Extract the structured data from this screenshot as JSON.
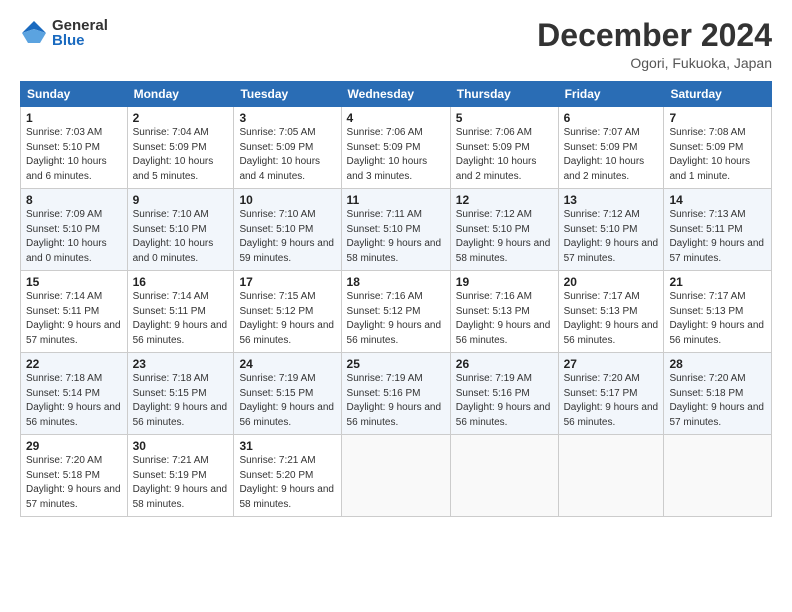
{
  "header": {
    "logo_general": "General",
    "logo_blue": "Blue",
    "month_title": "December 2024",
    "location": "Ogori, Fukuoka, Japan"
  },
  "days_of_week": [
    "Sunday",
    "Monday",
    "Tuesday",
    "Wednesday",
    "Thursday",
    "Friday",
    "Saturday"
  ],
  "weeks": [
    [
      {
        "day": "1",
        "sunrise": "7:03 AM",
        "sunset": "5:10 PM",
        "daylight": "10 hours and 6 minutes."
      },
      {
        "day": "2",
        "sunrise": "7:04 AM",
        "sunset": "5:09 PM",
        "daylight": "10 hours and 5 minutes."
      },
      {
        "day": "3",
        "sunrise": "7:05 AM",
        "sunset": "5:09 PM",
        "daylight": "10 hours and 4 minutes."
      },
      {
        "day": "4",
        "sunrise": "7:06 AM",
        "sunset": "5:09 PM",
        "daylight": "10 hours and 3 minutes."
      },
      {
        "day": "5",
        "sunrise": "7:06 AM",
        "sunset": "5:09 PM",
        "daylight": "10 hours and 2 minutes."
      },
      {
        "day": "6",
        "sunrise": "7:07 AM",
        "sunset": "5:09 PM",
        "daylight": "10 hours and 2 minutes."
      },
      {
        "day": "7",
        "sunrise": "7:08 AM",
        "sunset": "5:09 PM",
        "daylight": "10 hours and 1 minute."
      }
    ],
    [
      {
        "day": "8",
        "sunrise": "7:09 AM",
        "sunset": "5:10 PM",
        "daylight": "10 hours and 0 minutes."
      },
      {
        "day": "9",
        "sunrise": "7:10 AM",
        "sunset": "5:10 PM",
        "daylight": "10 hours and 0 minutes."
      },
      {
        "day": "10",
        "sunrise": "7:10 AM",
        "sunset": "5:10 PM",
        "daylight": "9 hours and 59 minutes."
      },
      {
        "day": "11",
        "sunrise": "7:11 AM",
        "sunset": "5:10 PM",
        "daylight": "9 hours and 58 minutes."
      },
      {
        "day": "12",
        "sunrise": "7:12 AM",
        "sunset": "5:10 PM",
        "daylight": "9 hours and 58 minutes."
      },
      {
        "day": "13",
        "sunrise": "7:12 AM",
        "sunset": "5:10 PM",
        "daylight": "9 hours and 57 minutes."
      },
      {
        "day": "14",
        "sunrise": "7:13 AM",
        "sunset": "5:11 PM",
        "daylight": "9 hours and 57 minutes."
      }
    ],
    [
      {
        "day": "15",
        "sunrise": "7:14 AM",
        "sunset": "5:11 PM",
        "daylight": "9 hours and 57 minutes."
      },
      {
        "day": "16",
        "sunrise": "7:14 AM",
        "sunset": "5:11 PM",
        "daylight": "9 hours and 56 minutes."
      },
      {
        "day": "17",
        "sunrise": "7:15 AM",
        "sunset": "5:12 PM",
        "daylight": "9 hours and 56 minutes."
      },
      {
        "day": "18",
        "sunrise": "7:16 AM",
        "sunset": "5:12 PM",
        "daylight": "9 hours and 56 minutes."
      },
      {
        "day": "19",
        "sunrise": "7:16 AM",
        "sunset": "5:13 PM",
        "daylight": "9 hours and 56 minutes."
      },
      {
        "day": "20",
        "sunrise": "7:17 AM",
        "sunset": "5:13 PM",
        "daylight": "9 hours and 56 minutes."
      },
      {
        "day": "21",
        "sunrise": "7:17 AM",
        "sunset": "5:13 PM",
        "daylight": "9 hours and 56 minutes."
      }
    ],
    [
      {
        "day": "22",
        "sunrise": "7:18 AM",
        "sunset": "5:14 PM",
        "daylight": "9 hours and 56 minutes."
      },
      {
        "day": "23",
        "sunrise": "7:18 AM",
        "sunset": "5:15 PM",
        "daylight": "9 hours and 56 minutes."
      },
      {
        "day": "24",
        "sunrise": "7:19 AM",
        "sunset": "5:15 PM",
        "daylight": "9 hours and 56 minutes."
      },
      {
        "day": "25",
        "sunrise": "7:19 AM",
        "sunset": "5:16 PM",
        "daylight": "9 hours and 56 minutes."
      },
      {
        "day": "26",
        "sunrise": "7:19 AM",
        "sunset": "5:16 PM",
        "daylight": "9 hours and 56 minutes."
      },
      {
        "day": "27",
        "sunrise": "7:20 AM",
        "sunset": "5:17 PM",
        "daylight": "9 hours and 56 minutes."
      },
      {
        "day": "28",
        "sunrise": "7:20 AM",
        "sunset": "5:18 PM",
        "daylight": "9 hours and 57 minutes."
      }
    ],
    [
      {
        "day": "29",
        "sunrise": "7:20 AM",
        "sunset": "5:18 PM",
        "daylight": "9 hours and 57 minutes."
      },
      {
        "day": "30",
        "sunrise": "7:21 AM",
        "sunset": "5:19 PM",
        "daylight": "9 hours and 58 minutes."
      },
      {
        "day": "31",
        "sunrise": "7:21 AM",
        "sunset": "5:20 PM",
        "daylight": "9 hours and 58 minutes."
      },
      null,
      null,
      null,
      null
    ]
  ]
}
